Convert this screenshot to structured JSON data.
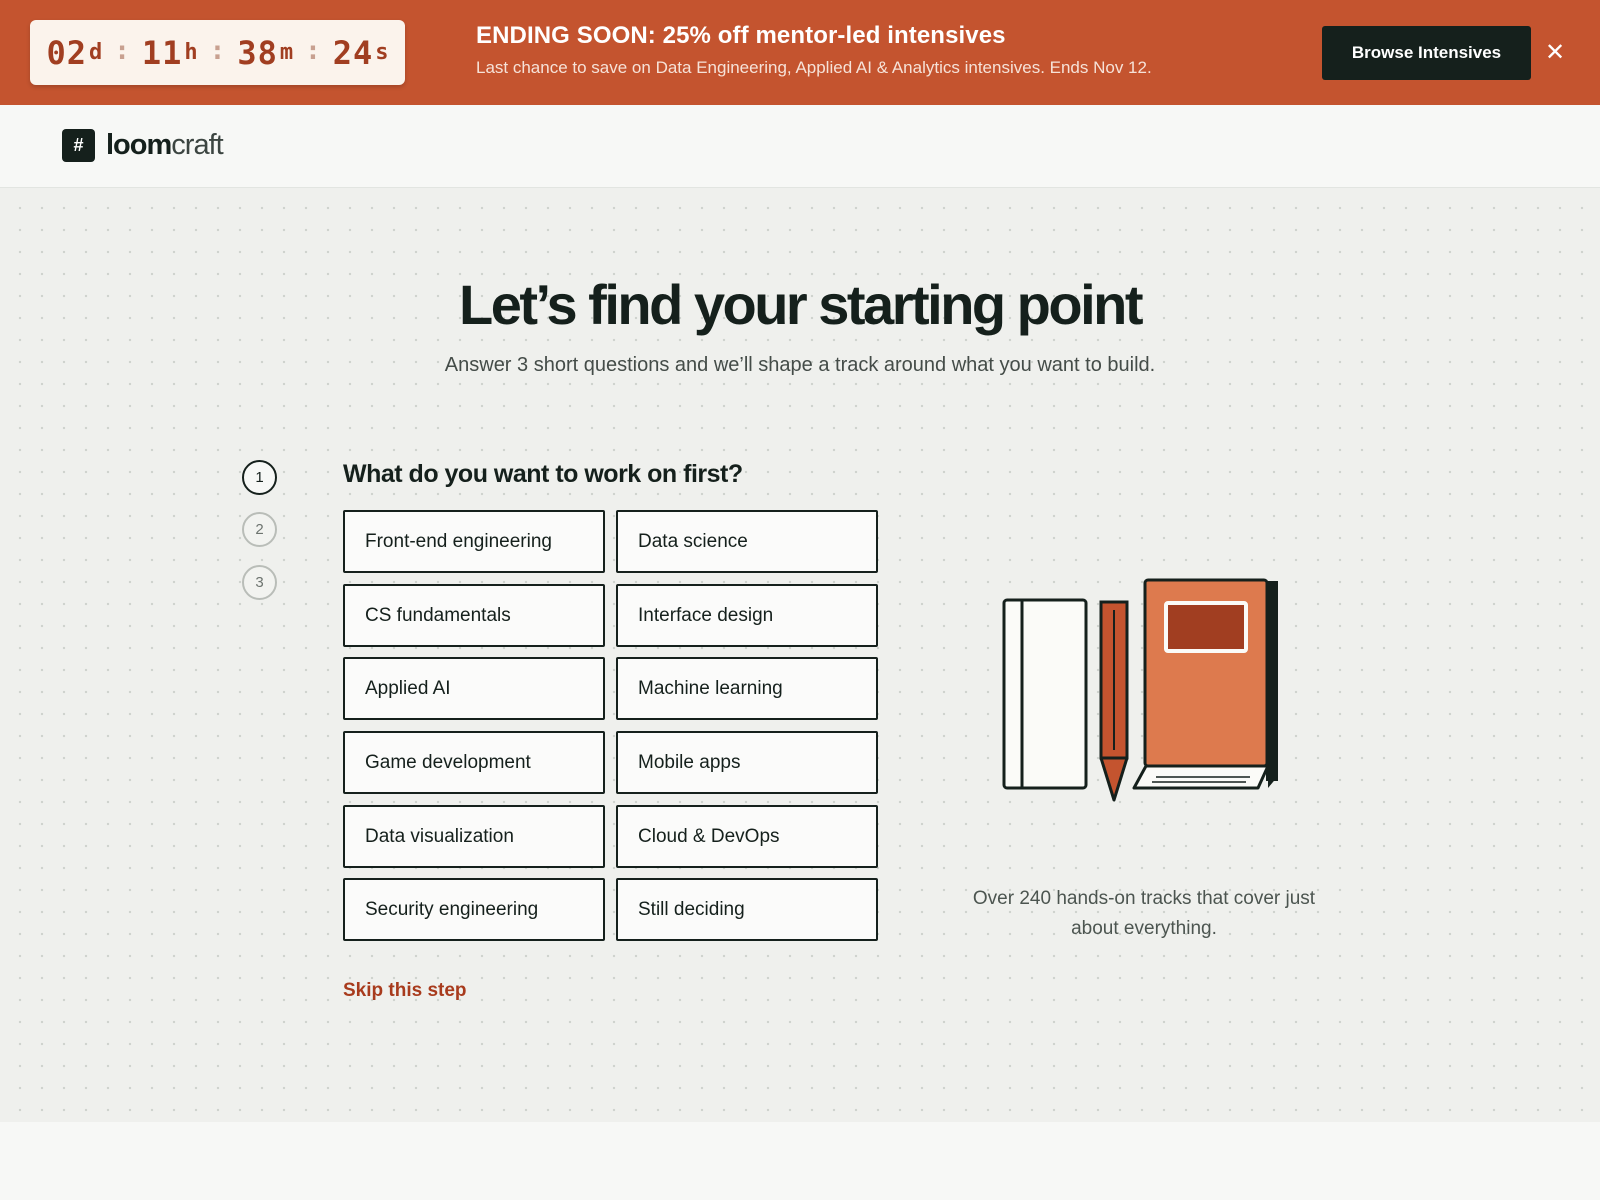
{
  "promo": {
    "countdown": {
      "days": "02",
      "days_unit": "d",
      "hours": "11",
      "hours_unit": "h",
      "minutes": "38",
      "minutes_unit": "m",
      "seconds": "24",
      "seconds_unit": "s",
      "separator": ":"
    },
    "title": "ENDING SOON: 25% off mentor-led intensives",
    "subtitle": "Last chance to save on Data Engineering, Applied AI & Analytics intensives. Ends Nov 12.",
    "cta_label": "Browse Intensives",
    "close_icon": "close-icon",
    "close_glyph": "✕",
    "background_color": "#c4542f"
  },
  "header": {
    "logo_icon": "grid-hash-icon",
    "logo_glyph": "#",
    "logo_bold": "loom",
    "logo_light": "craft"
  },
  "hero": {
    "title": "Let’s find your starting point",
    "subtitle": "Answer 3 short questions and we’ll shape a track around what you want to build."
  },
  "steps": [
    {
      "label": "1",
      "active": true
    },
    {
      "label": "2",
      "active": false
    },
    {
      "label": "3",
      "active": false
    }
  ],
  "question": "What do you want to work on first?",
  "options": [
    "Front-end engineering",
    "Data science",
    "CS fundamentals",
    "Interface design",
    "Applied AI",
    "Machine learning",
    "Game development",
    "Mobile apps",
    "Data visualization",
    "Cloud & DevOps",
    "Security engineering",
    "Still deciding"
  ],
  "skip_label": "Skip this step",
  "illustration": {
    "icon": "notebook-pencil-book-illustration",
    "caption": "Over 240 hands-on tracks that cover just about everything."
  },
  "colors": {
    "accent": "#c4542f",
    "dark": "#15201c",
    "link": "#a83b1d"
  }
}
